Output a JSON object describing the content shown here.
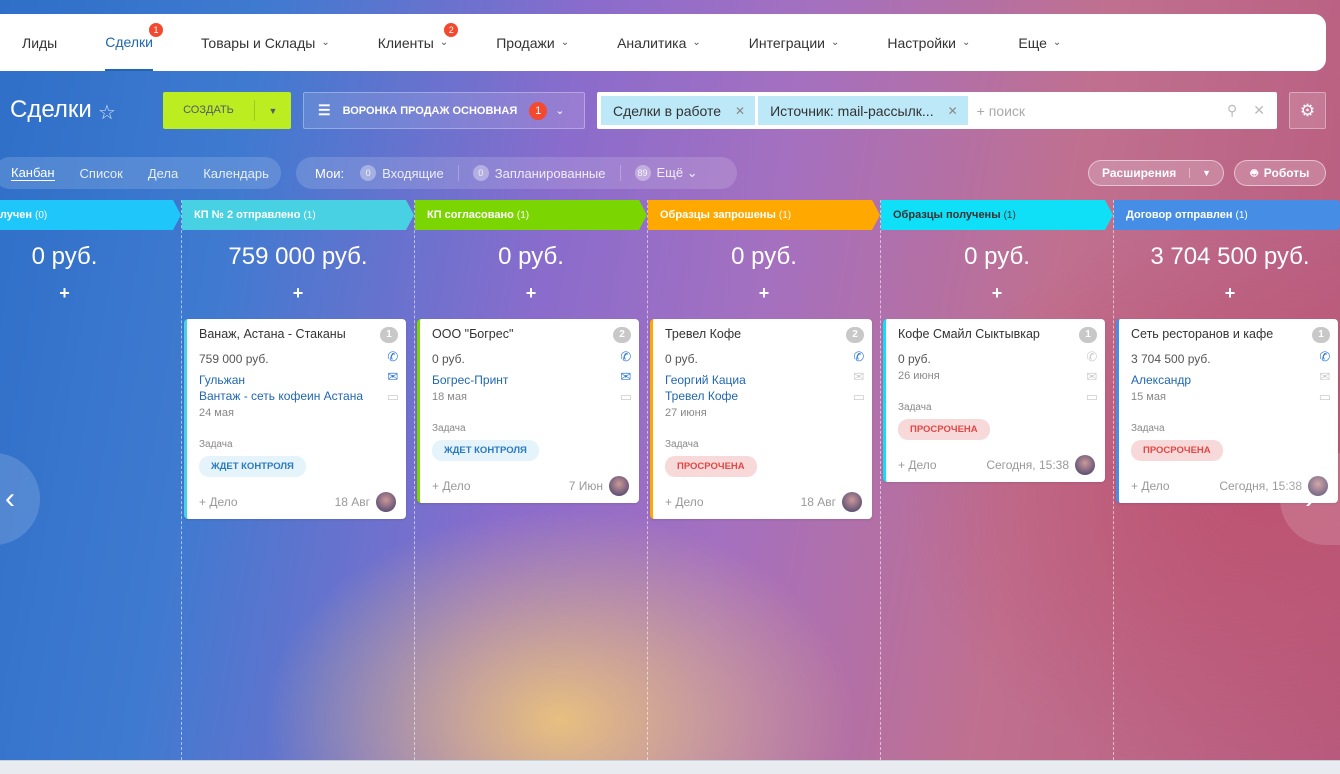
{
  "nav": [
    {
      "label": "Лиды"
    },
    {
      "label": "Сделки",
      "active": true,
      "badge": "1"
    },
    {
      "label": "Товары и Склады",
      "chev": true
    },
    {
      "label": "Клиенты",
      "chev": true,
      "badge": "2"
    },
    {
      "label": "Продажи",
      "chev": true
    },
    {
      "label": "Аналитика",
      "chev": true
    },
    {
      "label": "Интеграции",
      "chev": true
    },
    {
      "label": "Настройки",
      "chev": true
    },
    {
      "label": "Еще",
      "chev": true
    }
  ],
  "header": {
    "title": "Сделки",
    "create_label": "СОЗДАТЬ",
    "funnel_label": "ВОРОНКА ПРОДАЖ ОСНОВНАЯ",
    "funnel_badge": "1",
    "filters": [
      "Сделки в работе",
      "Источник: mail-рассылк..."
    ],
    "search_placeholder": "+ поиск"
  },
  "views": [
    "Канбан",
    "Список",
    "Дела",
    "Календарь"
  ],
  "counters": {
    "label": "Мои:",
    "items": [
      {
        "n": "0",
        "label": "Входящие"
      },
      {
        "n": "0",
        "label": "Запланированные"
      },
      {
        "n": "89",
        "label": "Ещё ⌄"
      }
    ]
  },
  "extensions_label": "Расширения",
  "robots_label": "Роботы",
  "columns": [
    {
      "stage": "счёт получен",
      "count": "(0)",
      "color": "#1ec6fa",
      "sum": "0 руб.",
      "cards": []
    },
    {
      "stage": "КП № 2 отправлено",
      "count": "(1)",
      "color": "#47d1e2",
      "sum": "759 000 руб.",
      "cards": [
        {
          "name": "Ванаж, Астана - Стаканы",
          "num": "1",
          "price": "759 000 руб.",
          "links": [
            "Гульжан",
            "Вантаж - сеть кофеин Астана"
          ],
          "date": "24 мая",
          "task_label": "Задача",
          "tag": "ЖДЕТ КОНТРОЛЯ",
          "tag_type": "wait",
          "add": "+ Дело",
          "time": "18 Авг",
          "phone": true,
          "mail": true
        }
      ]
    },
    {
      "stage": "КП согласовано",
      "count": "(1)",
      "color": "#7bd500",
      "sum": "0 руб.",
      "cards": [
        {
          "name": "ООО \"Богрес\"",
          "num": "2",
          "price": "0 руб.",
          "links": [
            "Богрес-Принт"
          ],
          "date": "18 мая",
          "task_label": "Задача",
          "tag": "ЖДЕТ КОНТРОЛЯ",
          "tag_type": "wait",
          "add": "+ Дело",
          "time": "7 Июн",
          "phone": true,
          "mail": true
        }
      ]
    },
    {
      "stage": "Образцы запрошены",
      "count": "(1)",
      "color": "#ffa900",
      "sum": "0 руб.",
      "cards": [
        {
          "name": "Тревел Кофе",
          "num": "2",
          "price": "0 руб.",
          "links": [
            "Георгий Кациа",
            "Тревел Кофе"
          ],
          "date": "27 июня",
          "task_label": "Задача",
          "tag": "ПРОСРОЧЕНА",
          "tag_type": "late",
          "add": "+ Дело",
          "time": "18 Авг",
          "phone": true,
          "mail": false
        }
      ]
    },
    {
      "stage": "Образцы получены",
      "count": "(1)",
      "color": "#0fe0f8",
      "sum": "0 руб.",
      "dark": true,
      "cards": [
        {
          "name": "Кофе Смайл Сыктывкар",
          "num": "1",
          "price": "0 руб.",
          "links": [],
          "date": "26 июня",
          "task_label": "Задача",
          "tag": "ПРОСРОЧЕНА",
          "tag_type": "late",
          "add": "+ Дело",
          "time": "Сегодня, 15:38",
          "phone": false,
          "mail": false
        }
      ]
    },
    {
      "stage": "Договор отправлен",
      "count": "(1)",
      "color": "#468ee5",
      "sum": "3 704 500 руб.",
      "cards": [
        {
          "name": "Сеть ресторанов и кафе",
          "num": "1",
          "price": "3 704 500 руб.",
          "links": [
            "Александр"
          ],
          "date": "15 мая",
          "task_label": "Задача",
          "tag": "ПРОСРОЧЕНА",
          "tag_type": "late",
          "add": "+ Дело",
          "time": "Сегодня, 15:38",
          "phone": true,
          "mail": false
        }
      ]
    }
  ]
}
